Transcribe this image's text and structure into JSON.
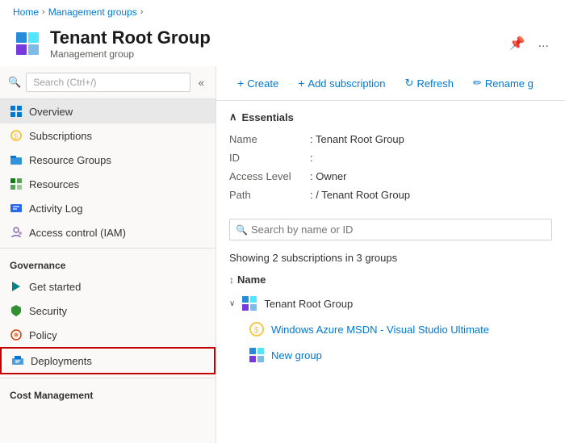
{
  "breadcrumb": {
    "items": [
      "Home",
      "Management groups"
    ],
    "separators": [
      ">",
      ">"
    ]
  },
  "header": {
    "title": "Tenant Root Group",
    "subtitle": "Management group",
    "pin_label": "📌",
    "more_label": "..."
  },
  "toolbar": {
    "create_label": "Create",
    "add_subscription_label": "Add subscription",
    "refresh_label": "Refresh",
    "rename_label": "Rename g"
  },
  "sidebar": {
    "search_placeholder": "Search (Ctrl+/)",
    "nav_items": [
      {
        "id": "overview",
        "label": "Overview",
        "active": true
      },
      {
        "id": "subscriptions",
        "label": "Subscriptions",
        "active": false
      },
      {
        "id": "resource-groups",
        "label": "Resource Groups",
        "active": false
      },
      {
        "id": "resources",
        "label": "Resources",
        "active": false
      },
      {
        "id": "activity-log",
        "label": "Activity Log",
        "active": false
      },
      {
        "id": "access-control",
        "label": "Access control (IAM)",
        "active": false
      }
    ],
    "sections": [
      {
        "label": "Governance",
        "items": [
          {
            "id": "get-started",
            "label": "Get started",
            "active": false
          },
          {
            "id": "security",
            "label": "Security",
            "active": false
          },
          {
            "id": "policy",
            "label": "Policy",
            "active": false
          },
          {
            "id": "deployments",
            "label": "Deployments",
            "active": false,
            "highlighted": true
          }
        ]
      },
      {
        "label": "Cost Management",
        "items": []
      }
    ]
  },
  "essentials": {
    "title": "Essentials",
    "fields": [
      {
        "label": "Name",
        "value": ": Tenant Root Group"
      },
      {
        "label": "ID",
        "value": ":"
      },
      {
        "label": "Access Level",
        "value": ": Owner"
      },
      {
        "label": "Path",
        "value": ": / Tenant Root Group"
      }
    ]
  },
  "content": {
    "search_placeholder": "Search by name or ID",
    "showing_label": "Showing 2 subscriptions in 3 groups",
    "sort_column": "Name",
    "tree": [
      {
        "id": "tenant-root",
        "label": "Tenant Root Group",
        "expanded": true,
        "children": [
          {
            "id": "windows-azure-msdn",
            "label": "Windows Azure MSDN - Visual Studio Ultimate",
            "type": "subscription"
          },
          {
            "id": "new-group",
            "label": "New group",
            "type": "group"
          }
        ]
      }
    ]
  }
}
